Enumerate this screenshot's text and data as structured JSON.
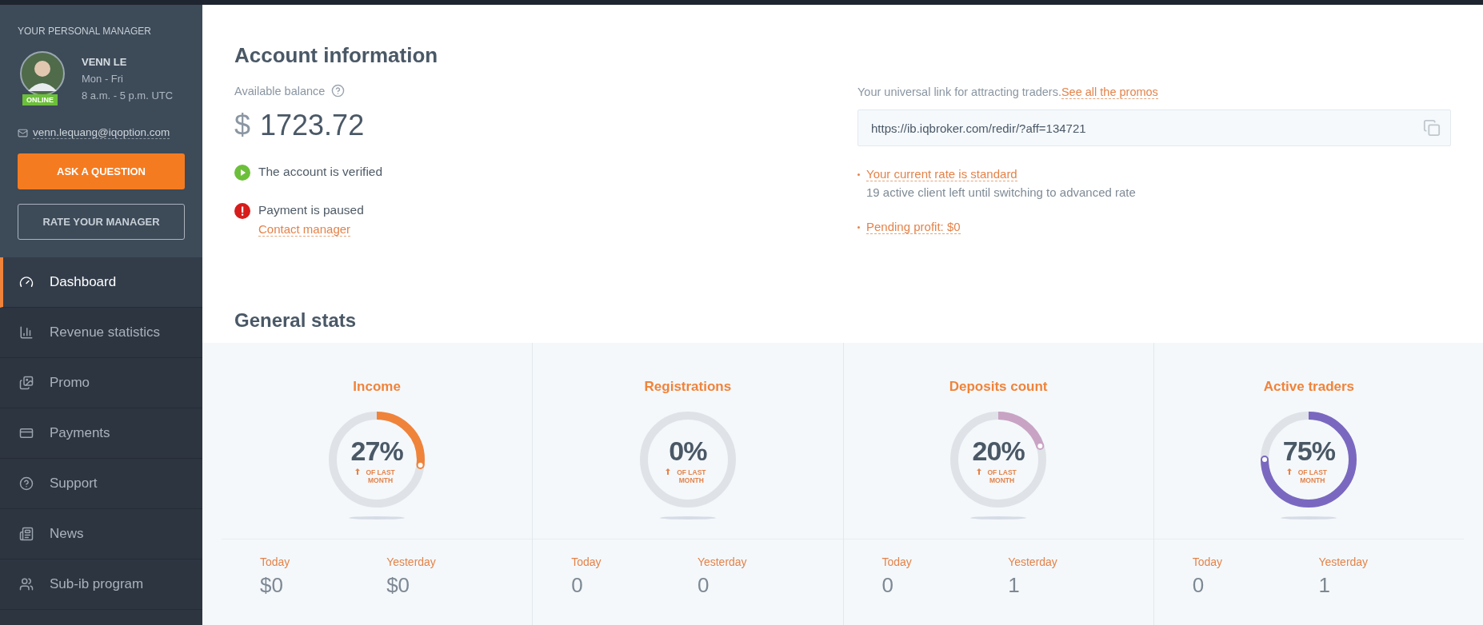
{
  "manager": {
    "heading": "YOUR PERSONAL MANAGER",
    "name": "VENN LE",
    "days": "Mon - Fri",
    "hours": "8 a.m. - 5 p.m. UTC",
    "status": "ONLINE",
    "online": true,
    "email": "venn.lequang@iqoption.com",
    "ask_button": "ASK A QUESTION",
    "rate_button": "RATE YOUR MANAGER"
  },
  "nav": [
    {
      "label": "Dashboard",
      "kind": "gauge",
      "selected": true
    },
    {
      "label": "Revenue statistics",
      "kind": "chart",
      "selected": false
    },
    {
      "label": "Promo",
      "kind": "images",
      "selected": false
    },
    {
      "label": "Payments",
      "kind": "card",
      "selected": false
    },
    {
      "label": "Support",
      "kind": "help",
      "selected": false
    },
    {
      "label": "News",
      "kind": "news",
      "selected": false
    },
    {
      "label": "Sub-ib program",
      "kind": "users",
      "selected": false
    }
  ],
  "account": {
    "title": "Account information",
    "balance_label": "Available balance",
    "currency": "$",
    "balance": "1723.72",
    "statuses": [
      {
        "kind": "verified",
        "text": "The account is verified"
      },
      {
        "kind": "paused",
        "text": "Payment is paused",
        "link": "Contact manager"
      }
    ],
    "link_label": "Your universal link for attracting traders.",
    "promos_link": "See all the promos",
    "link_value": "https://ib.iqbroker.com/redir/?aff=134721",
    "rate_items": [
      {
        "text": "Your current rate is standard",
        "note": "19 active client left until switching to advanced rate"
      },
      {
        "text": "Pending profit: $0"
      }
    ]
  },
  "stats": {
    "title": "General stats",
    "cards": [
      {
        "title": "Income",
        "value": "27%",
        "note": "OF LAST MONTH",
        "color": "#f0833a",
        "today_label": "Today",
        "today": "$0",
        "yesterday_label": "Yesterday",
        "yesterday": "$0"
      },
      {
        "title": "Registrations",
        "value": "0%",
        "note": "OF LAST MONTH",
        "today_label": "Today",
        "today": "0",
        "yesterday_label": "Yesterday",
        "yesterday": "0"
      },
      {
        "title": "Deposits count",
        "value": "20%",
        "note": "OF LAST MONTH",
        "color": "#c9a3c4",
        "today_label": "Today",
        "today": "0",
        "yesterday_label": "Yesterday",
        "yesterday": "1"
      },
      {
        "title": "Active traders",
        "value": "75%",
        "note": "OF LAST MONTH",
        "color": "#7a68c0",
        "today_label": "Today",
        "today": "0",
        "yesterday_label": "Yesterday",
        "yesterday": "1"
      }
    ]
  }
}
